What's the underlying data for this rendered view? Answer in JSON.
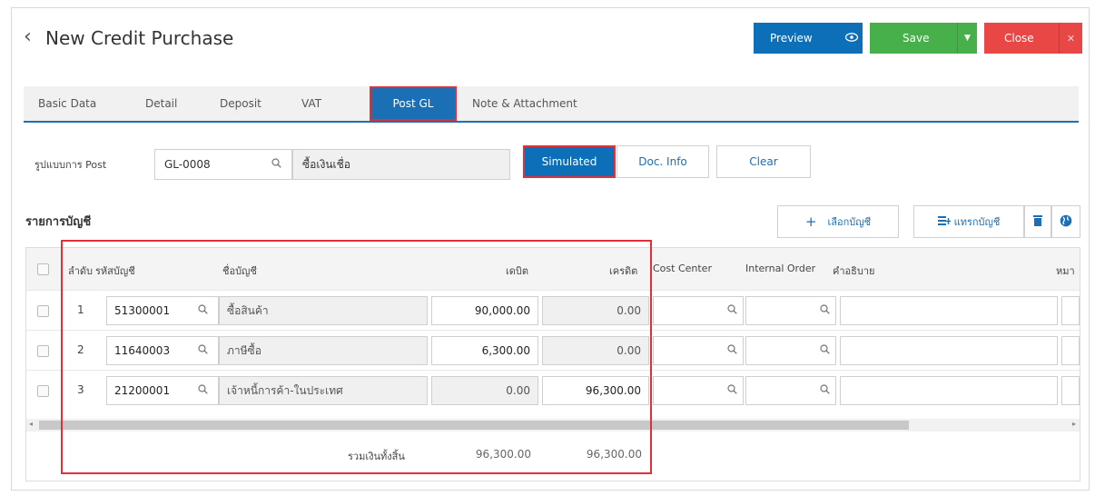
{
  "header": {
    "back_icon": "chevron-left-icon",
    "title": "New Credit Purchase",
    "preview_label": "Preview",
    "save_label": "Save",
    "close_label": "Close"
  },
  "tabs": [
    {
      "label": "Basic Data"
    },
    {
      "label": "Detail"
    },
    {
      "label": "Deposit"
    },
    {
      "label": "VAT"
    },
    {
      "label": "Post GL",
      "active": true
    },
    {
      "label": "Note & Attachment"
    }
  ],
  "post_form": {
    "label": "รูปแบบการ Post",
    "code": "GL-0008",
    "name": "ซื้อเงินเชื่อ",
    "simulated_label": "Simulated",
    "doc_info_label": "Doc. Info",
    "clear_label": "Clear"
  },
  "accounts": {
    "section_title": "รายการบัญชี",
    "select_account_label": "เลือกบัญชี",
    "insert_account_label": "แทรกบัญชี",
    "columns": {
      "seq": "ลำดับ",
      "code": "รหัสบัญชี",
      "name": "ชื่อบัญชี",
      "debit": "เดบิต",
      "credit": "เครดิต",
      "cost_center": "Cost Center",
      "internal_order": "Internal Order",
      "description": "คำอธิบาย",
      "note": "หมา"
    },
    "rows": [
      {
        "seq": "1",
        "code": "51300001",
        "name": "ซื้อสินค้า",
        "debit": "90,000.00",
        "credit": "0.00"
      },
      {
        "seq": "2",
        "code": "11640003",
        "name": "ภาษีซื้อ",
        "debit": "6,300.00",
        "credit": "0.00"
      },
      {
        "seq": "3",
        "code": "21200001",
        "name": "เจ้าหนี้การค้า-ในประเทศ",
        "debit": "0.00",
        "credit": "96,300.00"
      }
    ],
    "total_label": "รวมเงินทั้งสิ้น",
    "total_debit": "96,300.00",
    "total_credit": "96,300.00"
  },
  "colors": {
    "primary": "#0d6fb8",
    "save": "#47b04b",
    "close": "#e94646",
    "highlight": "#e0303a"
  }
}
